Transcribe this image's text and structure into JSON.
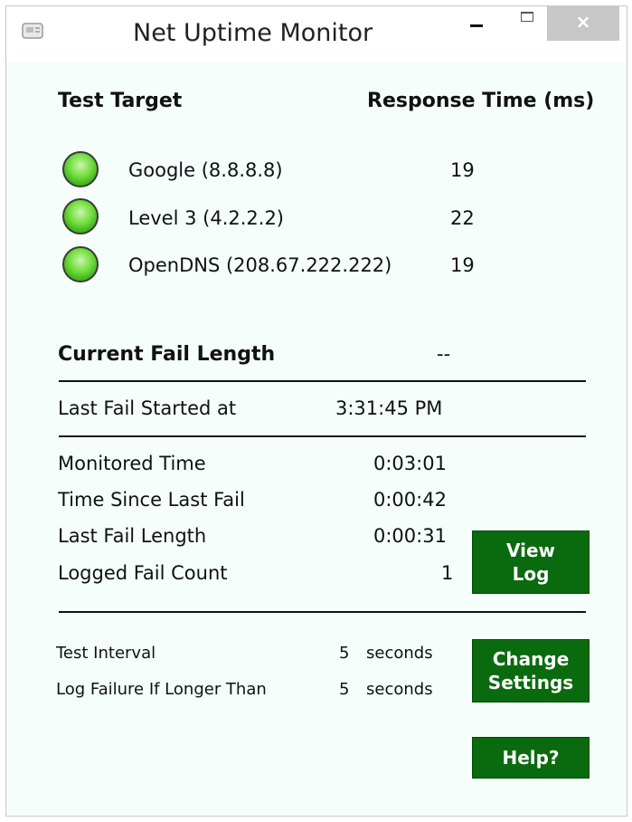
{
  "window": {
    "title": "Net Uptime Monitor",
    "close_glyph": "×"
  },
  "headers": {
    "test_target": "Test Target",
    "response_time": "Response Time (ms)"
  },
  "targets": [
    {
      "name": "Google (8.8.8.8)",
      "response": "19",
      "status_color": "#5ad12b"
    },
    {
      "name": "Level 3 (4.2.2.2)",
      "response": "22",
      "status_color": "#5ad12b"
    },
    {
      "name": "OpenDNS (208.67.222.222)",
      "response": "19",
      "status_color": "#5ad12b"
    }
  ],
  "current_fail": {
    "label": "Current Fail Length",
    "value": "--"
  },
  "last_fail_started": {
    "label": "Last Fail Started at",
    "value": "3:31:45 PM"
  },
  "stats": [
    {
      "label": "Monitored Time",
      "value": "0:03:01"
    },
    {
      "label": "Time Since Last Fail",
      "value": "0:00:42"
    },
    {
      "label": "Last Fail Length",
      "value": "0:00:31"
    },
    {
      "label": "Logged Fail Count",
      "value": "1"
    }
  ],
  "settings": [
    {
      "label": "Test Interval",
      "value": "5",
      "unit": "seconds"
    },
    {
      "label": "Log Failure If Longer Than",
      "value": "5",
      "unit": "seconds"
    }
  ],
  "buttons": {
    "view_log_line1": "View",
    "view_log_line2": "Log",
    "change_settings_line1": "Change",
    "change_settings_line2": "Settings",
    "help": "Help?"
  },
  "colors": {
    "accent_button": "#0a6a0e",
    "background": "#f5fefb"
  }
}
